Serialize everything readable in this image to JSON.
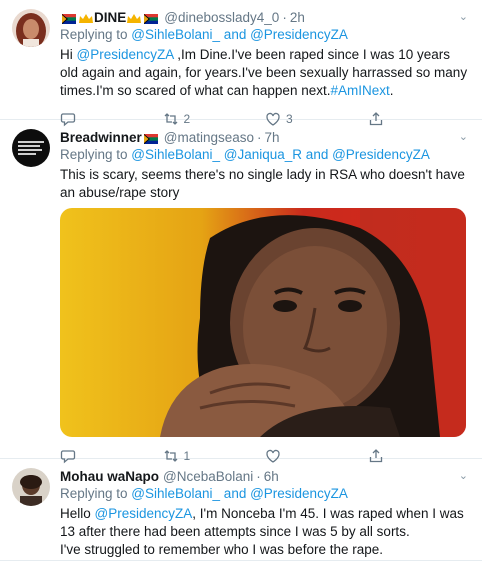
{
  "tweets": [
    {
      "name": "DINE",
      "handle": "@dinebosslady4_0",
      "sep": "·",
      "time": "2h",
      "reply_prefix": "Replying to ",
      "reply_to": "@SihleBolani_ and @PresidencyZA",
      "text_a": "Hi ",
      "mention": "@PresidencyZA",
      "text_b": " ,Im Dine.I've been raped since I was 10 years old again and again, for years.I've been sexually harrassed so many times.I'm so scared of what can happen next.",
      "hashtag": "#AmINext",
      "text_c": ".",
      "reply_count": "",
      "retweet_count": "2",
      "like_count": "3",
      "icons": [
        "reply-icon",
        "retweet-icon",
        "like-icon",
        "share-icon"
      ]
    },
    {
      "name": "Breadwinner",
      "handle": "@matingseaso",
      "sep": "·",
      "time": "7h",
      "reply_prefix": "Replying to ",
      "reply_to": "@SihleBolani_ @Janiqua_R and @PresidencyZA",
      "text": "This is scary, seems there's no single lady in RSA who doesn't have an abuse/rape story",
      "retweet_count": "1",
      "like_count": ""
    },
    {
      "name": "Mohau waNapo",
      "handle": "@NcebaBolani",
      "sep": "·",
      "time": "6h",
      "reply_prefix": "Replying to ",
      "reply_to": "@SihleBolani_ and @PresidencyZA",
      "text_a": "Hello ",
      "mention": "@PresidencyZA",
      "text_b": ", I'm Nonceba I'm 45. I was raped when I was 13 after there had been attempts since I was 5 by all sorts.",
      "text_c": "I've struggled to remember who I was before the rape."
    }
  ],
  "colors": {
    "link": "#1b95e0",
    "secondary": "#657786",
    "divider": "#e6ecf0",
    "like_hover": "#e0245e",
    "retweet_hover": "#17bf63"
  }
}
